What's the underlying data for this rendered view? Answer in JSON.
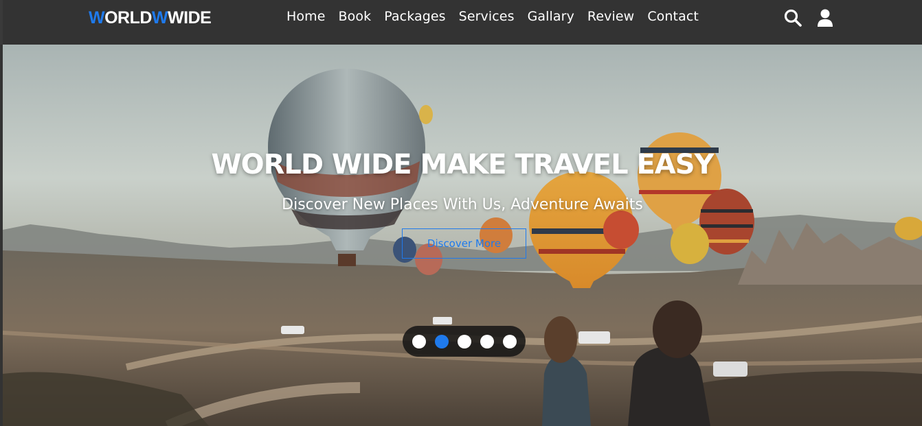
{
  "logo": {
    "part1_accent": "W",
    "part1_rest": "ORLD",
    "part2_accent": "W",
    "part2_rest": "WIDE"
  },
  "nav": {
    "items": [
      {
        "label": "Home"
      },
      {
        "label": "Book"
      },
      {
        "label": "Packages"
      },
      {
        "label": "Services"
      },
      {
        "label": "Gallary"
      },
      {
        "label": "Review"
      },
      {
        "label": "Contact"
      }
    ]
  },
  "header_icons": [
    "search-icon",
    "user-icon"
  ],
  "hero": {
    "title": "WORLD WIDE MAKE TRAVEL EASY",
    "subtitle": "Discover New Places With Us, Adventure Awaits",
    "cta": "Discover More",
    "slides": 5,
    "active_slide": 2
  },
  "colors": {
    "accent": "#1f7aec",
    "header_bg": "#333333",
    "text": "#ffffff"
  }
}
